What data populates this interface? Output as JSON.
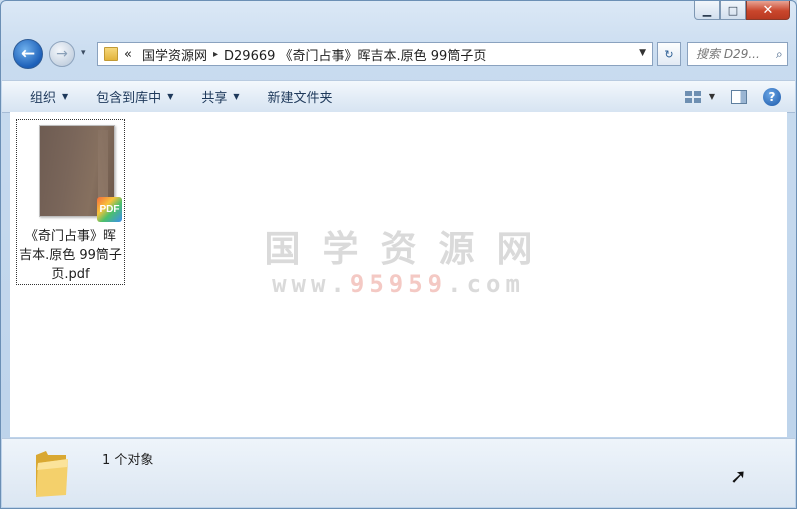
{
  "window": {
    "caption": {
      "minimize": "▁",
      "maximize": "□",
      "close": "✕"
    }
  },
  "nav": {
    "back_icon": "←",
    "forward_icon": "→",
    "history_dropdown": "▾",
    "breadcrumb": [
      "«",
      "国学资源网",
      "▸",
      "D29669 《奇门占事》晖吉本.原色 99筒子页"
    ],
    "refresh_icon": "↻",
    "search_placeholder": "搜索 D29...",
    "search_icon": "⌕"
  },
  "toolbar": {
    "items": [
      "组织",
      "包含到库中",
      "共享",
      "新建文件夹"
    ],
    "dropdown_arrow": "▼",
    "help": "?"
  },
  "content": {
    "file": {
      "name": "《奇门占事》晖吉本.原色 99筒子页.pdf",
      "badge": "PDF"
    },
    "watermark": {
      "title": "国学资源网",
      "url_prefix": "www.",
      "url_number": "95959",
      "url_suffix": ".com"
    }
  },
  "status": {
    "text": "1 个对象"
  }
}
